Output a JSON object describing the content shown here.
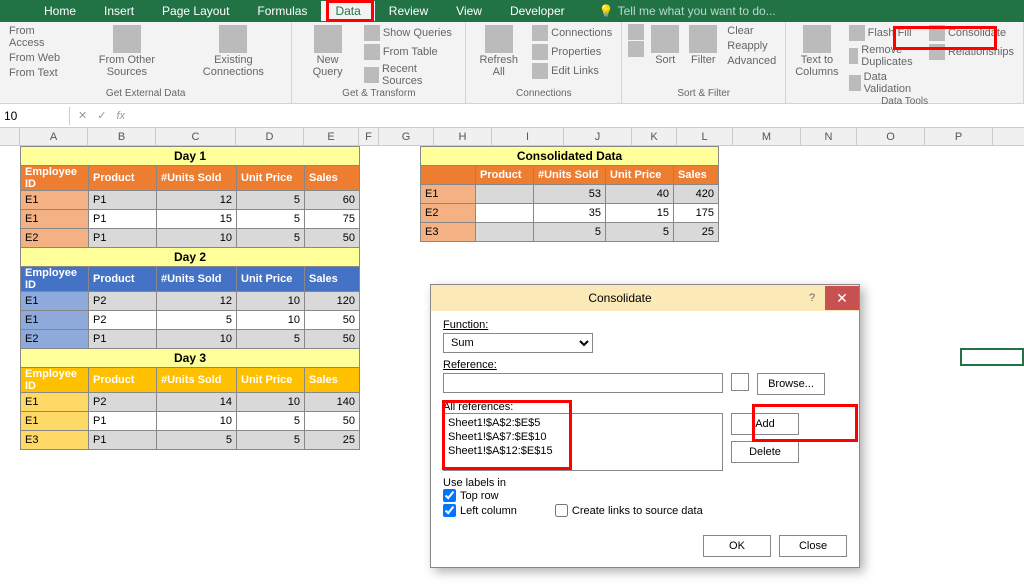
{
  "tabs": [
    "Home",
    "Insert",
    "Page Layout",
    "Formulas",
    "Data",
    "Review",
    "View",
    "Developer"
  ],
  "active_tab": "Data",
  "tell_me": "Tell me what you want to do...",
  "ribbon": {
    "get_external": {
      "label": "Get External Data",
      "items": [
        "From Access",
        "From Web",
        "From Text",
        "From Other Sources",
        "Existing Connections"
      ]
    },
    "get_transform": {
      "label": "Get & Transform",
      "new_query": "New Query",
      "items": [
        "Show Queries",
        "From Table",
        "Recent Sources"
      ]
    },
    "connections": {
      "label": "Connections",
      "refresh": "Refresh All",
      "items": [
        "Connections",
        "Properties",
        "Edit Links"
      ]
    },
    "sort_filter": {
      "label": "Sort & Filter",
      "sort": "Sort",
      "filter": "Filter",
      "items": [
        "Clear",
        "Reapply",
        "Advanced"
      ]
    },
    "data_tools": {
      "label": "Data Tools",
      "text_to_cols": "Text to Columns",
      "items": [
        "Flash Fill",
        "Remove Duplicates",
        "Data Validation",
        "Consolidate",
        "Relationships"
      ]
    }
  },
  "name_box": "10",
  "columns": [
    "A",
    "B",
    "C",
    "D",
    "E",
    "F",
    "G",
    "H",
    "I",
    "J",
    "K",
    "L",
    "M",
    "N",
    "O",
    "P"
  ],
  "day1": {
    "title": "Day 1",
    "headers": [
      "Employee ID",
      "Product",
      "#Units Sold",
      "Unit Price",
      "Sales"
    ],
    "rows": [
      [
        "E1",
        "P1",
        "12",
        "5",
        "60"
      ],
      [
        "E1",
        "P1",
        "15",
        "5",
        "75"
      ],
      [
        "E2",
        "P1",
        "10",
        "5",
        "50"
      ]
    ]
  },
  "day2": {
    "title": "Day 2",
    "headers": [
      "Employee ID",
      "Product",
      "#Units Sold",
      "Unit Price",
      "Sales"
    ],
    "rows": [
      [
        "E1",
        "P2",
        "12",
        "10",
        "120"
      ],
      [
        "E1",
        "P2",
        "5",
        "10",
        "50"
      ],
      [
        "E2",
        "P1",
        "10",
        "5",
        "50"
      ]
    ]
  },
  "day3": {
    "title": "Day 3",
    "headers": [
      "Employee ID",
      "Product",
      "#Units Sold",
      "Unit Price",
      "Sales"
    ],
    "rows": [
      [
        "E1",
        "P2",
        "14",
        "10",
        "140"
      ],
      [
        "E1",
        "P1",
        "10",
        "5",
        "50"
      ],
      [
        "E3",
        "P1",
        "5",
        "5",
        "25"
      ]
    ]
  },
  "consolidated": {
    "title": "Consolidated Data",
    "headers": [
      "",
      "Product",
      "#Units Sold",
      "Unit Price",
      "Sales"
    ],
    "rows": [
      [
        "E1",
        "",
        "53",
        "40",
        "420"
      ],
      [
        "E2",
        "",
        "35",
        "15",
        "175"
      ],
      [
        "E3",
        "",
        "5",
        "5",
        "25"
      ]
    ]
  },
  "dialog": {
    "title": "Consolidate",
    "function_label": "Function:",
    "function_value": "Sum",
    "reference_label": "Reference:",
    "all_refs_label": "All references:",
    "refs": [
      "Sheet1!$A$2:$E$5",
      "Sheet1!$A$7:$E$10",
      "Sheet1!$A$12:$E$15"
    ],
    "use_labels": "Use labels in",
    "top_row": "Top row",
    "top_row_checked": true,
    "left_col": "Left column",
    "left_col_checked": true,
    "create_links": "Create links to source data",
    "create_links_checked": false,
    "browse": "Browse...",
    "add": "Add",
    "delete": "Delete",
    "ok": "OK",
    "close": "Close"
  }
}
